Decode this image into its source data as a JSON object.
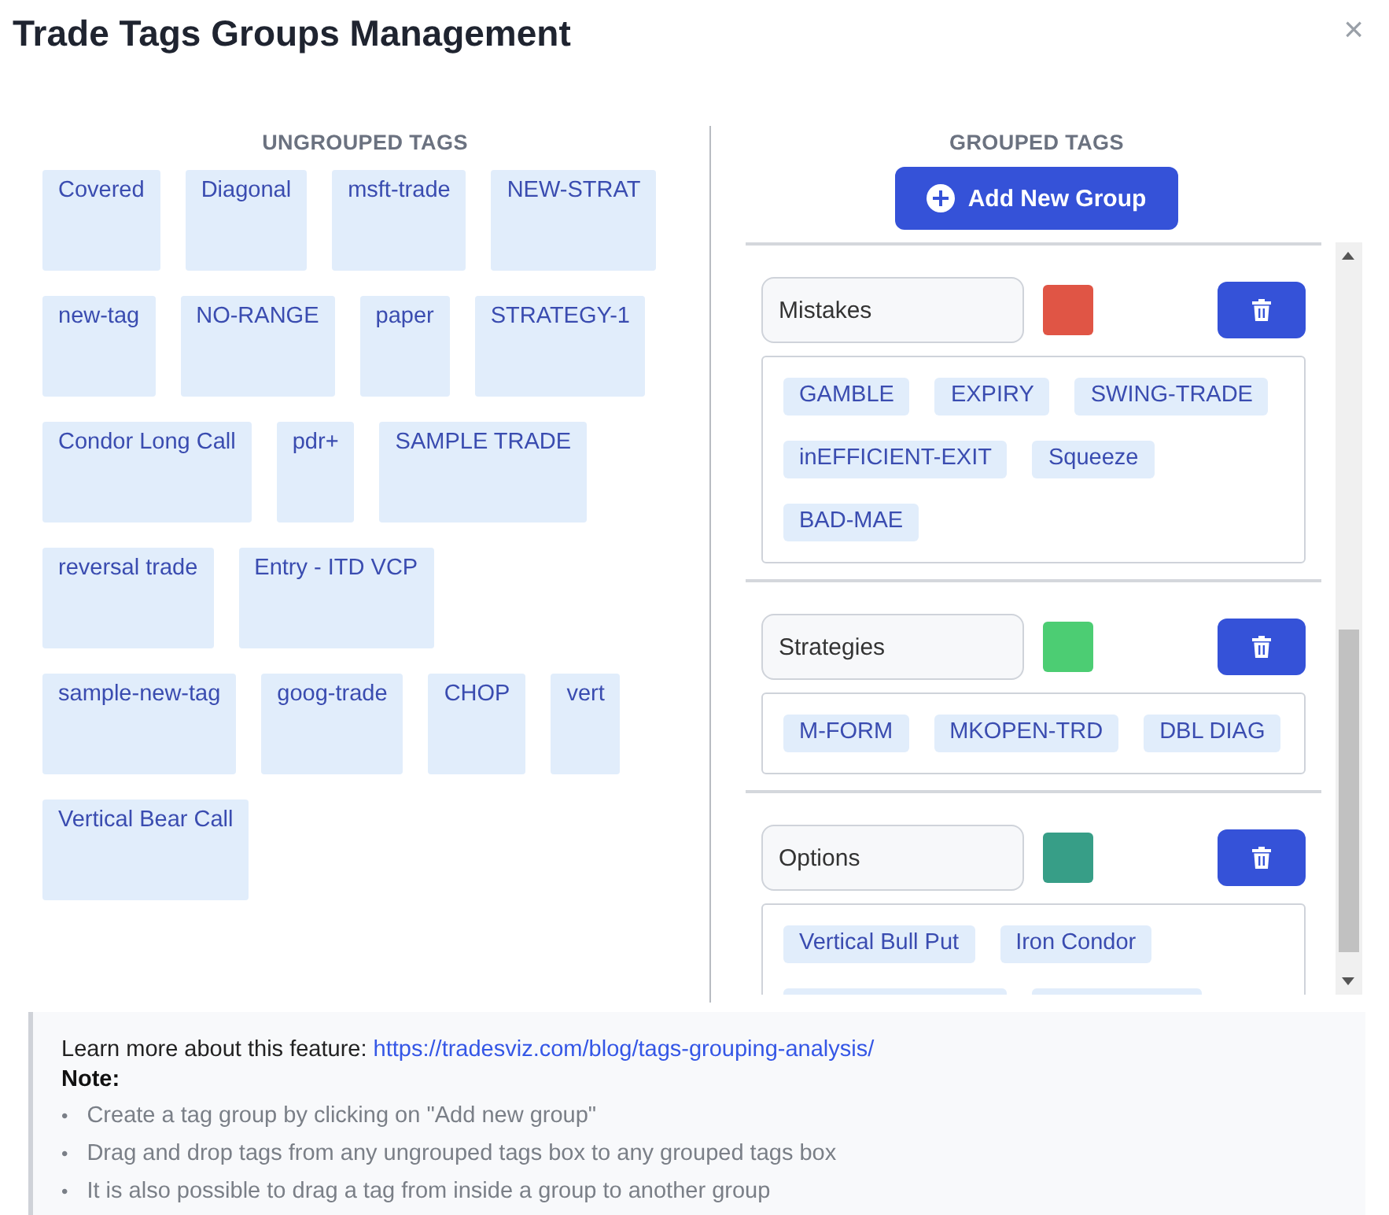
{
  "title": "Trade Tags Groups Management",
  "close": "×",
  "ungrouped": {
    "heading": "UNGROUPED TAGS",
    "rows": [
      [
        "Covered",
        "Diagonal",
        "msft-trade",
        "NEW-STRAT"
      ],
      [
        "new-tag",
        "NO-RANGE",
        "paper",
        "STRATEGY-1"
      ],
      [
        "Condor Long Call",
        "pdr+",
        "SAMPLE TRADE"
      ],
      [
        "reversal trade",
        "Entry - ITD VCP"
      ],
      [
        "sample-new-tag",
        "goog-trade",
        "CHOP",
        "vert"
      ],
      [
        "Vertical Bear Call"
      ]
    ]
  },
  "grouped": {
    "heading": "GROUPED TAGS",
    "add_button": "Add New Group",
    "groups": [
      {
        "name": "Mistakes",
        "color": "#e05545",
        "tags": [
          "GAMBLE",
          "EXPIRY",
          "SWING-TRADE",
          "inEFFICIENT-EXIT",
          "Squeeze",
          "BAD-MAE"
        ]
      },
      {
        "name": "Strategies",
        "color": "#4ccd73",
        "tags": [
          "M-FORM",
          "MKOPEN-TRD",
          "DBL DIAG"
        ]
      },
      {
        "name": "Options",
        "color": "#379e87",
        "tags": [
          "Vertical Bull Put",
          "Iron Condor"
        ]
      }
    ]
  },
  "note": {
    "intro": "Learn more about this feature: ",
    "link": "https://tradesviz.com/blog/tags-grouping-analysis/",
    "label": "Note:",
    "bullet": "•",
    "items": [
      "Create a tag group by clicking on \"Add new group\"",
      "Drag and drop tags from any ungrouped tags box to any grouped tags box",
      "It is also possible to drag a tag from inside a group to another group"
    ]
  }
}
